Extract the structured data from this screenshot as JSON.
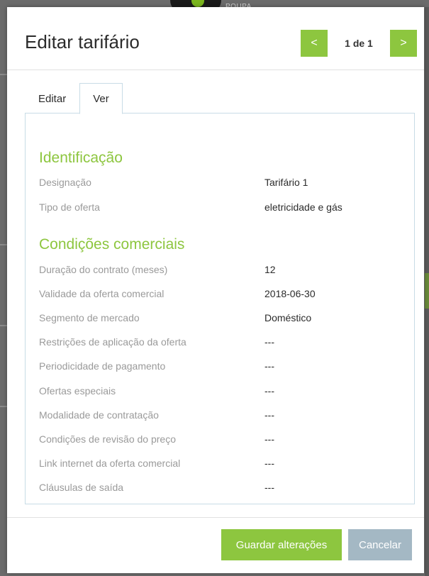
{
  "background": {
    "logo_text": "POUPA"
  },
  "modal": {
    "title": "Editar tarifário",
    "pager": {
      "prev_label": "<",
      "position_label": "1 de 1",
      "next_label": ">"
    },
    "tabs": [
      {
        "label": "Editar",
        "active": false
      },
      {
        "label": "Ver",
        "active": true
      }
    ]
  },
  "identificacao": {
    "title": "Identificação",
    "rows": [
      {
        "label": "Designação",
        "value": "Tarifário 1"
      },
      {
        "label": "Tipo de oferta",
        "value": "eletricidade e gás"
      }
    ]
  },
  "condicoes": {
    "title": "Condições comerciais",
    "rows": [
      {
        "label": "Duração do contrato (meses)",
        "value": "12"
      },
      {
        "label": "Validade da oferta comercial",
        "value": "2018-06-30"
      },
      {
        "label": "Segmento de mercado",
        "value": "Doméstico"
      },
      {
        "label": "Restrições de aplicação da oferta",
        "value": "---"
      },
      {
        "label": "Periodicidade de pagamento",
        "value": "---"
      },
      {
        "label": "Ofertas especiais",
        "value": "---"
      },
      {
        "label": "Modalidade de contratação",
        "value": "---"
      },
      {
        "label": "Condições de revisão do preço",
        "value": "---"
      },
      {
        "label": "Link internet da oferta comercial",
        "value": "---"
      },
      {
        "label": "Cláusulas de saída",
        "value": "---"
      }
    ]
  },
  "footer": {
    "save_label": "Guardar alterações",
    "cancel_label": "Cancelar"
  },
  "colors": {
    "accent": "#8dc63f",
    "cancel": "#a4b8c4",
    "panel_border": "#c8dce6"
  }
}
